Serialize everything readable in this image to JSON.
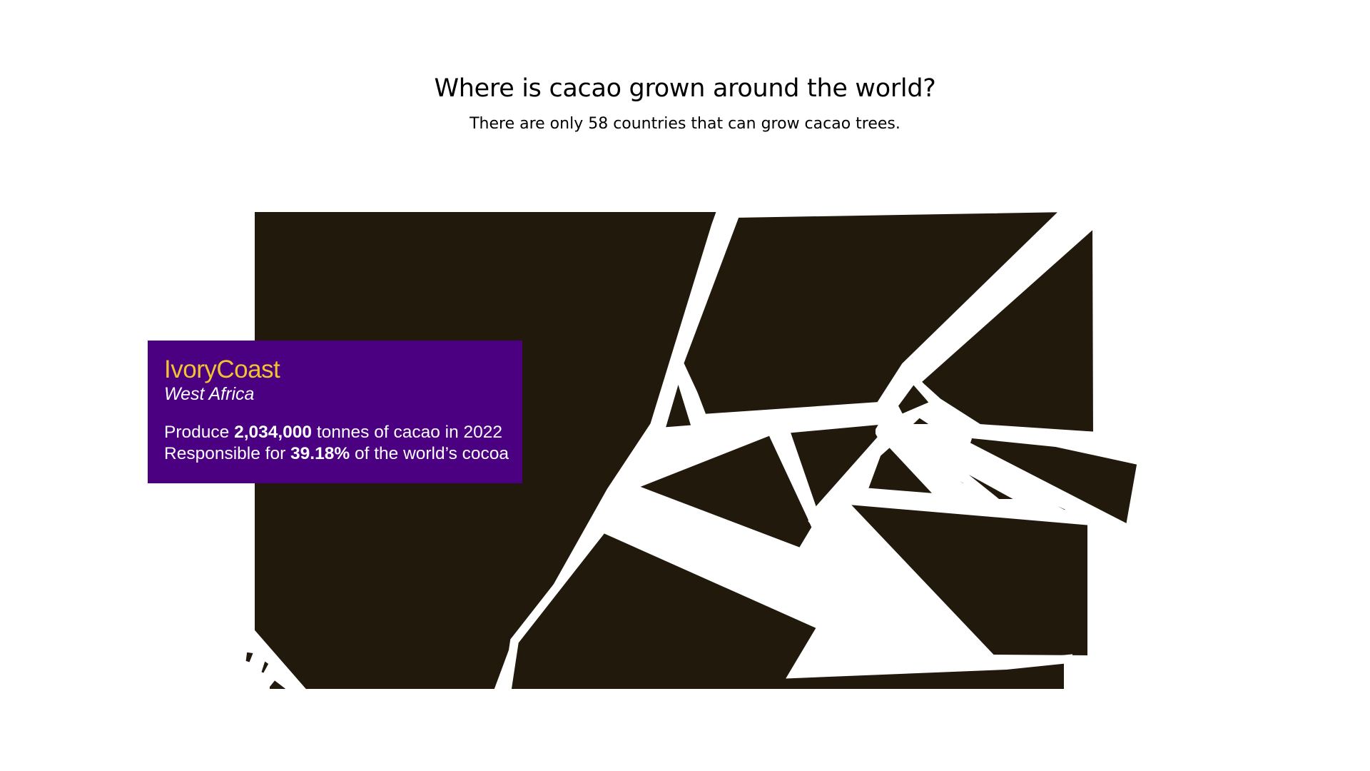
{
  "header": {
    "title": "Where is cacao grown around the world?",
    "subtitle": "There are only 58 countries that can grow cacao trees."
  },
  "colors": {
    "cell_fill": "#22190d",
    "cell_stroke": "#ffffff",
    "tooltip_bg": "#4b0082",
    "tooltip_country": "#f2c231",
    "tooltip_text": "#ffffff"
  },
  "tooltip": {
    "country": "IvoryCoast",
    "region": "West Africa",
    "line1_prefix": "Produce ",
    "line1_value": "2,034,000",
    "line1_suffix": " tonnes of cacao in 2022",
    "line2_prefix": "Responsible for ",
    "line2_value": "39.18%",
    "line2_suffix": " of the world’s cocoa"
  },
  "chart_data": {
    "type": "voronoi-treemap",
    "title": "Where is cacao grown around the world?",
    "subtitle": "There are only 58 countries that can grow cacao trees.",
    "total_countries": 58,
    "highlighted": {
      "country": "IvoryCoast",
      "region": "West Africa",
      "production_tonnes": 2034000,
      "year": 2022,
      "share_percent": 39.18
    }
  }
}
